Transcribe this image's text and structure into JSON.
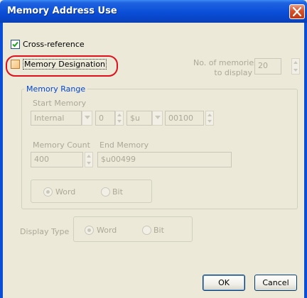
{
  "window": {
    "title": "Memory Address Use"
  },
  "cross_reference": {
    "label": "Cross-reference",
    "checked": true
  },
  "memory_designation": {
    "label": "Memory Designation",
    "checked": false
  },
  "memories_to_display": {
    "label_line1": "No. of memories",
    "label_line2": "to display",
    "value": "20"
  },
  "memory_range": {
    "title": "Memory Range",
    "start_memory_label": "Start Memory",
    "area_value": "Internal",
    "number_value": "0",
    "prefix_value": "$u",
    "address_value": "00100",
    "memory_count_label": "Memory Count",
    "memory_count_value": "400",
    "end_memory_label": "End Memory",
    "end_memory_value": "$u00499",
    "word_label": "Word",
    "bit_label": "Bit"
  },
  "display_type": {
    "label": "Display Type",
    "word_label": "Word",
    "bit_label": "Bit"
  },
  "buttons": {
    "ok": "OK",
    "cancel": "Cancel"
  }
}
